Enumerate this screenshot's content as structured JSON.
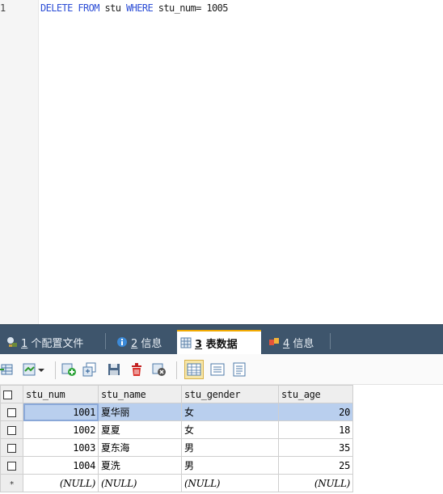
{
  "editor": {
    "line_number": "1",
    "query": {
      "kw1": "DELETE FROM",
      "t1": " stu ",
      "kw2": "WHERE",
      "t2": " stu_num= 1005"
    }
  },
  "tabs": [
    {
      "num": "1",
      "label": " 个配置文件"
    },
    {
      "num": "2",
      "label": " 信息"
    },
    {
      "num": "3",
      "label": " 表数据"
    },
    {
      "num": "4",
      "label": " 信息"
    }
  ],
  "grid": {
    "columns": [
      "stu_num",
      "stu_name",
      "stu_gender",
      "stu_age"
    ],
    "rows": [
      {
        "stu_num": "1001",
        "stu_name": "夏华丽",
        "stu_gender": "女",
        "stu_age": "20"
      },
      {
        "stu_num": "1002",
        "stu_name": "夏夏",
        "stu_gender": "女",
        "stu_age": "18"
      },
      {
        "stu_num": "1003",
        "stu_name": "夏东海",
        "stu_gender": "男",
        "stu_age": "35"
      },
      {
        "stu_num": "1004",
        "stu_name": "夏洗",
        "stu_gender": "男",
        "stu_age": "25"
      }
    ],
    "new_row": {
      "marker": "*",
      "stu_num": "(NULL)",
      "stu_name": "(NULL)",
      "stu_gender": "(NULL)",
      "stu_age": "(NULL)"
    }
  },
  "colors": {
    "keyword": "#2e4fd6",
    "tabbar": "#3e556c",
    "active_tab_accent": "#f1a900",
    "selected_row": "#b9cfee"
  },
  "icons": {
    "tab1": "profiles-icon",
    "tab2": "info-icon",
    "tab3": "table-data-icon",
    "tab4": "info-icon",
    "toolbar": [
      "grid-export-icon",
      "import-icon",
      "add-row-icon",
      "duplicate-row-icon",
      "save-icon",
      "delete-icon",
      "cancel-icon",
      "grid-view-icon",
      "form-view-icon",
      "text-view-icon"
    ]
  }
}
